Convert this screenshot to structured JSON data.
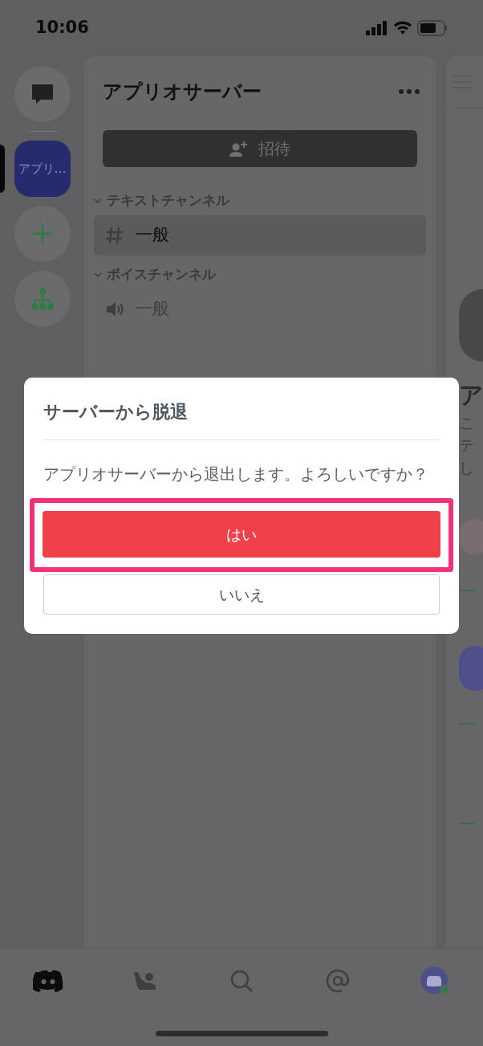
{
  "status_bar": {
    "time": "10:06"
  },
  "server_rail": {
    "items": [
      {
        "kind": "dms",
        "selected": false
      },
      {
        "kind": "server",
        "label": "アプリ…",
        "selected": true
      },
      {
        "kind": "add",
        "selected": false
      },
      {
        "kind": "discover",
        "selected": false
      }
    ]
  },
  "channel_panel": {
    "title": "アプリオサーバー",
    "invite_button": "招待",
    "categories": [
      {
        "name": "テキストチャンネル",
        "expanded": true,
        "channels": [
          {
            "kind": "text",
            "name": "一般",
            "selected": true
          }
        ]
      },
      {
        "name": "ボイスチャンネル",
        "expanded": true,
        "channels": [
          {
            "kind": "voice",
            "name": "一般",
            "selected": false
          }
        ]
      }
    ]
  },
  "right_panel": {
    "heading": "ア",
    "lines": [
      "こ",
      "テ",
      "し"
    ]
  },
  "dialog": {
    "title": "サーバーから脱退",
    "message": "アプリオサーバーから退出します。よろしいですか？",
    "buttons": [
      {
        "kind": "confirm",
        "label": "はい",
        "highlighted": true
      },
      {
        "kind": "cancel",
        "label": "いいえ",
        "highlighted": false
      }
    ]
  },
  "tab_bar": {
    "items": [
      {
        "kind": "home",
        "selected": true
      },
      {
        "kind": "friends",
        "selected": false
      },
      {
        "kind": "search",
        "selected": false
      },
      {
        "kind": "mentions",
        "selected": false
      },
      {
        "kind": "profile",
        "selected": false
      }
    ]
  }
}
